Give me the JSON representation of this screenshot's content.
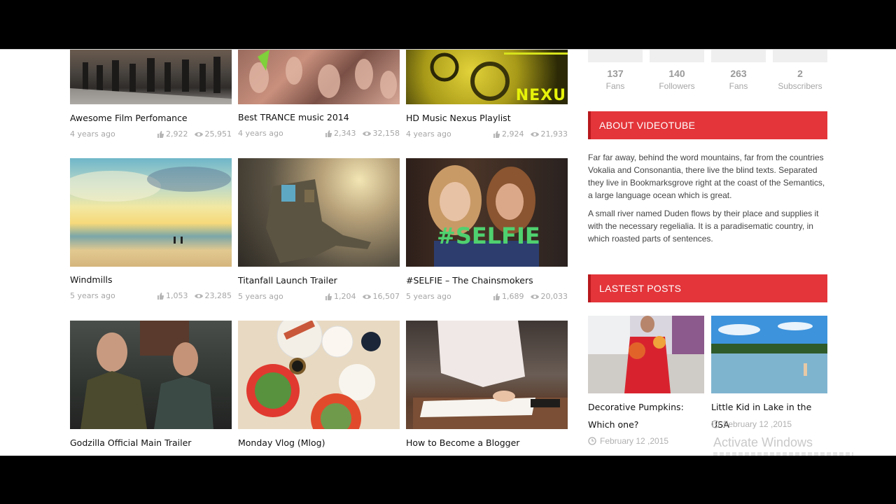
{
  "videos": [
    {
      "title": "Awesome Film Perfomance",
      "age": "4 years ago",
      "likes": "2,922",
      "views": "25,951"
    },
    {
      "title": "Best TRANCE music 2014",
      "age": "4 years ago",
      "likes": "2,343",
      "views": "32,158"
    },
    {
      "title": "HD Music Nexus Playlist",
      "age": "4 years ago",
      "likes": "2,924",
      "views": "21,933",
      "overlay": "NEXU"
    },
    {
      "title": "Windmills",
      "age": "5 years ago",
      "likes": "1,053",
      "views": "23,285"
    },
    {
      "title": "Titanfall Launch Trailer",
      "age": "5 years ago",
      "likes": "1,204",
      "views": "16,507"
    },
    {
      "title": "#SELFIE – The Chainsmokers",
      "age": "5 years ago",
      "likes": "1,689",
      "views": "20,033",
      "overlay": "#SELFIE"
    },
    {
      "title": "Godzilla Official Main Trailer"
    },
    {
      "title": "Monday Vlog (Mlog)"
    },
    {
      "title": "How to Become a Blogger"
    }
  ],
  "social": [
    {
      "count": "137",
      "label": "Fans"
    },
    {
      "count": "140",
      "label": "Followers"
    },
    {
      "count": "263",
      "label": "Fans"
    },
    {
      "count": "2",
      "label": "Subscribers"
    }
  ],
  "about": {
    "heading": "ABOUT VIDEOTUBE",
    "p1": "Far far away, behind the word mountains, far from the countries Vokalia and Consonantia, there live the blind texts. Separated they live in Bookmarksgrove right at the coast of the Semantics, a large language ocean which is great.",
    "p2": "A small river named Duden flows by their place and supplies it with the necessary regelialia. It is a paradisematic country, in which roasted parts of sentences."
  },
  "latest": {
    "heading": "LASTEST POSTS",
    "posts": [
      {
        "title": "Decorative Pumpkins: Which one?",
        "date": "February 12 ,2015"
      },
      {
        "title": "Little Kid in Lake in the USA",
        "date": "February 12 ,2015"
      }
    ]
  },
  "watermark": "Activate Windows",
  "colors": {
    "accent": "#e3353a",
    "accent_dark": "#b8181d",
    "meta": "#a6a6a6"
  }
}
